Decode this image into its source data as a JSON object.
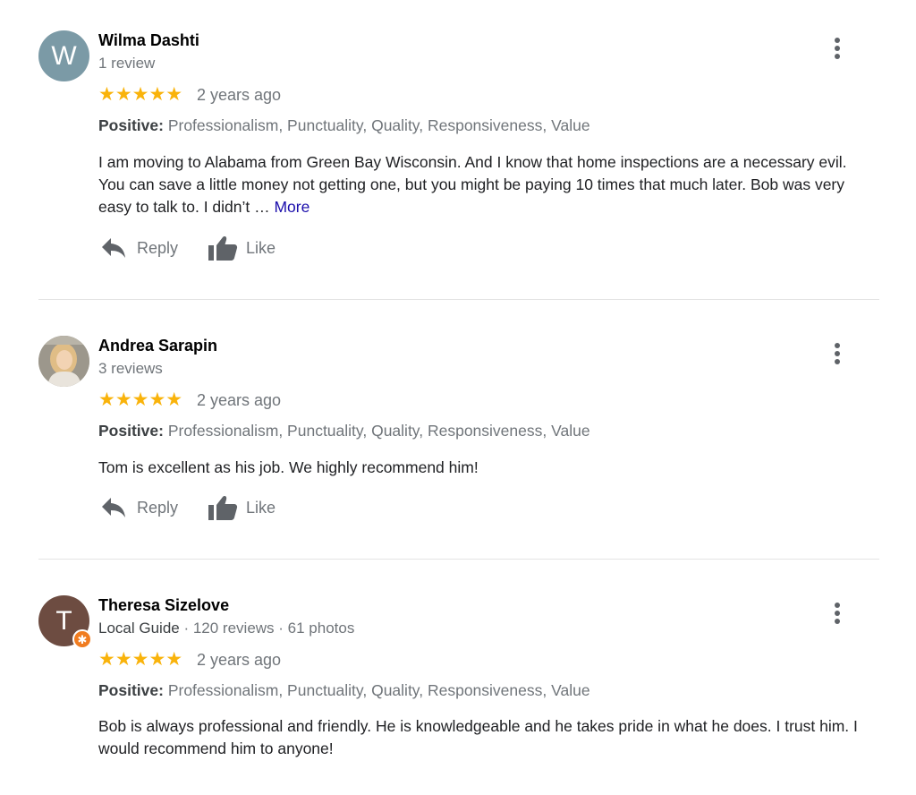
{
  "reviews": [
    {
      "avatar_letter": "W",
      "avatar_color": "#7b9aa6",
      "name": "Wilma Dashti",
      "meta": "1 review",
      "stars": "★★★★★",
      "rating": 5,
      "time": "2 years ago",
      "positive_label": "Positive:",
      "positive_text": " Professionalism, Punctuality, Quality, Responsiveness, Value",
      "body": "I am moving to Alabama from Green Bay Wisconsin. And I know that home inspections are a necessary evil. You can save a little money  not getting one, but  you might be paying 10 times that much later. Bob was very easy to talk to. I didn’t … ",
      "more_label": "More",
      "reply_label": "Reply",
      "like_label": "Like"
    },
    {
      "avatar_letter": "",
      "name": "Andrea Sarapin",
      "meta": "3 reviews",
      "stars": "★★★★★",
      "rating": 5,
      "time": "2 years ago",
      "positive_label": "Positive:",
      "positive_text": " Professionalism, Punctuality, Quality, Responsiveness, Value",
      "body": "Tom is excellent as his job. We highly recommend him!",
      "reply_label": "Reply",
      "like_label": "Like"
    },
    {
      "avatar_letter": "T",
      "avatar_color": "#6d4c41",
      "name": "Theresa Sizelove",
      "meta_guide": "Local Guide",
      "meta": " · 120 reviews · 61 photos",
      "stars": "★★★★★",
      "rating": 5,
      "time": "2 years ago",
      "positive_label": "Positive:",
      "positive_text": " Professionalism, Punctuality, Quality, Responsiveness, Value",
      "body": "Bob is always professional and friendly. He is knowledgeable and he takes pride in what he does. I trust him. I would recommend him to anyone!"
    }
  ],
  "icons": {
    "reply": "reply-icon",
    "like": "thumbs-up-icon",
    "menu": "more-vert-icon",
    "guide_badge": "local-guide-star-icon"
  },
  "colors": {
    "star": "#f9b30b",
    "link": "#1a0dab",
    "secondary_text": "#70757a"
  }
}
